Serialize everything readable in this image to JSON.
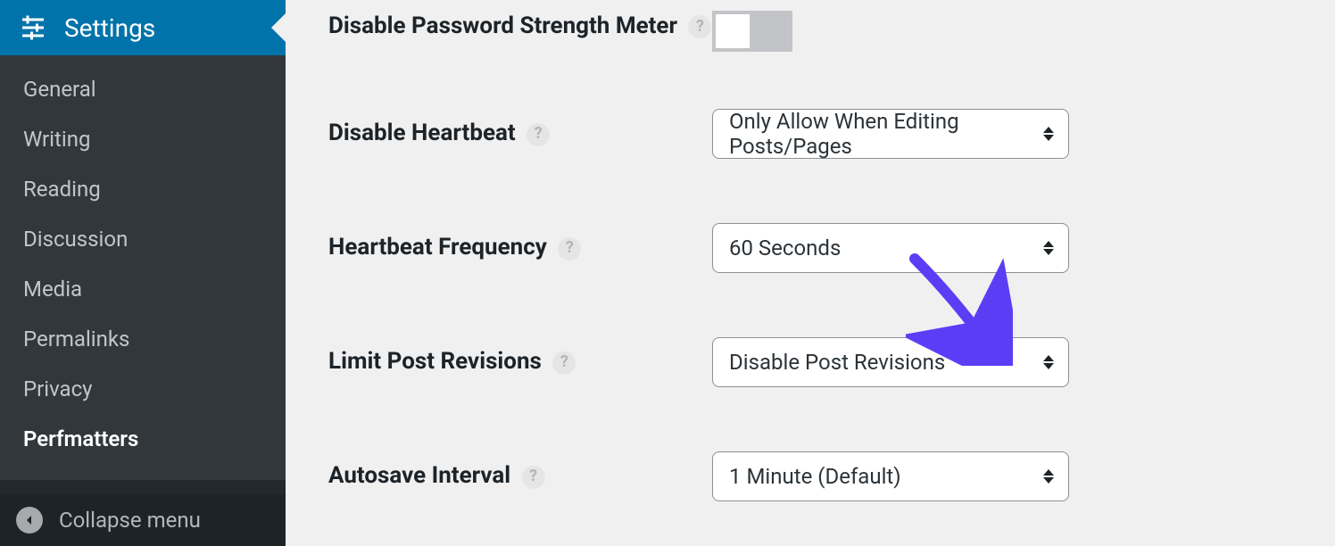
{
  "sidebar": {
    "header": {
      "label": "Settings"
    },
    "items": [
      {
        "label": "General"
      },
      {
        "label": "Writing"
      },
      {
        "label": "Reading"
      },
      {
        "label": "Discussion"
      },
      {
        "label": "Media"
      },
      {
        "label": "Permalinks"
      },
      {
        "label": "Privacy"
      },
      {
        "label": "Perfmatters"
      }
    ],
    "collapse_label": "Collapse menu"
  },
  "form": {
    "password_meter": {
      "label": "Disable Password Strength Meter",
      "help": "?",
      "value": false
    },
    "disable_heartbeat": {
      "label": "Disable Heartbeat",
      "help": "?",
      "value": "Only Allow When Editing Posts/Pages"
    },
    "heartbeat_frequency": {
      "label": "Heartbeat Frequency",
      "help": "?",
      "value": "60 Seconds"
    },
    "limit_post_revisions": {
      "label": "Limit Post Revisions",
      "help": "?",
      "value": "Disable Post Revisions"
    },
    "autosave_interval": {
      "label": "Autosave Interval",
      "help": "?",
      "value": "1 Minute (Default)"
    }
  },
  "annotation": {
    "color": "#5b3df5"
  }
}
